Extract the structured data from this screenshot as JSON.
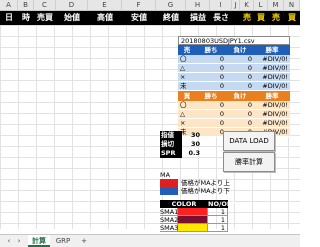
{
  "col_letters": [
    "A",
    "B",
    "C",
    "D",
    "E",
    "F",
    "G",
    "H",
    "I",
    "J",
    "K",
    "L",
    "M",
    "N"
  ],
  "header": [
    "日",
    "時",
    "売買",
    "始値",
    "高値",
    "安値",
    "終値",
    "損益",
    "長さ",
    "",
    "売",
    "買",
    "売",
    "買"
  ],
  "stats": {
    "filename": "20180803USDJPY1.csv",
    "sell": {
      "header": [
        "売",
        "勝ち",
        "負け",
        "勝率"
      ],
      "rows": [
        [
          "〇",
          "0",
          "0",
          "#DIV/0!"
        ],
        [
          "△",
          "0",
          "0",
          "#DIV/0!"
        ],
        [
          "×",
          "0",
          "0",
          "#DIV/0!"
        ],
        [
          "未",
          "0",
          "0",
          "#DIV/0!"
        ]
      ]
    },
    "buy": {
      "header": [
        "買",
        "勝ち",
        "負け",
        "勝率"
      ],
      "rows": [
        [
          "〇",
          "0",
          "0",
          "#DIV/0!"
        ],
        [
          "△",
          "0",
          "0",
          "#DIV/0!"
        ],
        [
          "×",
          "0",
          "0",
          "#DIV/0!"
        ],
        [
          "未",
          "0",
          "0",
          "#DIV/0!"
        ]
      ]
    }
  },
  "params": [
    {
      "label": "指値",
      "value": "30"
    },
    {
      "label": "損切",
      "value": "30"
    },
    {
      "label": "SPR",
      "value": "0.3"
    }
  ],
  "buttons": {
    "load": "DATA LOAD",
    "calc": "勝率計算"
  },
  "ma": {
    "title": "MA",
    "rows": [
      {
        "color": "#e02020",
        "label": "価格がMAより上"
      },
      {
        "color": "#1f5fb8",
        "label": "価格がMAより下"
      }
    ]
  },
  "color_table": {
    "header": [
      "COLOR",
      "NO/OFF"
    ],
    "rows": [
      {
        "name": "SMA1",
        "color": "#ff2020",
        "value": "1"
      },
      {
        "name": "SMA2",
        "color": "#7a1030",
        "value": "1"
      },
      {
        "name": "SMA3",
        "color": "#ffe800",
        "value": "1"
      }
    ]
  },
  "tabs": {
    "sheet1": "計算",
    "sheet2": "GRP",
    "add": "+"
  }
}
